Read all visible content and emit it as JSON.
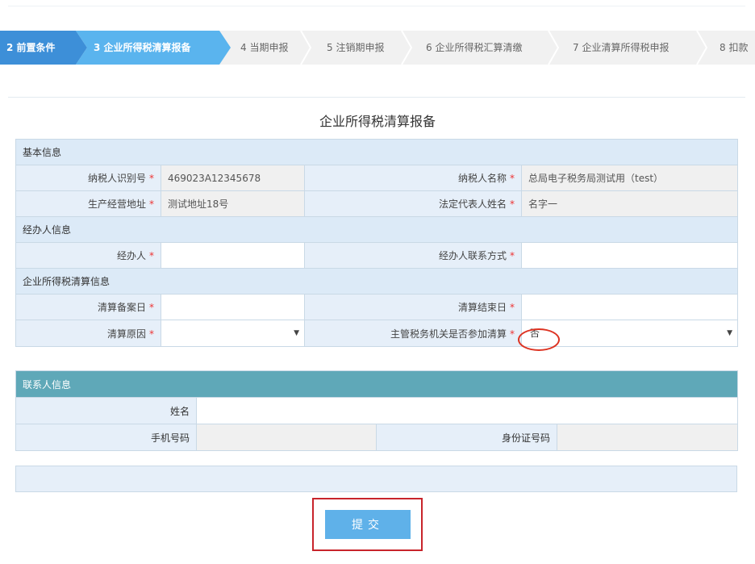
{
  "steps": [
    {
      "label": "2 前置条件",
      "state": "done"
    },
    {
      "label": "3 企业所得税清算报备",
      "state": "active"
    },
    {
      "label": "4 当期申报",
      "state": "todo"
    },
    {
      "label": "5 注销期申报",
      "state": "todo"
    },
    {
      "label": "6 企业所得税汇算清缴",
      "state": "todo"
    },
    {
      "label": "7 企业清算所得税申报",
      "state": "todo"
    },
    {
      "label": "8 扣款",
      "state": "todo"
    }
  ],
  "page_title": "企业所得税清算报备",
  "basic_section": "基本信息",
  "basic": {
    "taxpayer_id_label": "纳税人识别号",
    "taxpayer_id_value": "469023A12345678",
    "taxpayer_name_label": "纳税人名称",
    "taxpayer_name_value": "总局电子税务局测试用（test）",
    "address_label": "生产经营地址",
    "address_value": "测试地址18号",
    "legal_rep_label": "法定代表人姓名",
    "legal_rep_value": "名字一"
  },
  "agent_section": "经办人信息",
  "agent": {
    "agent_label": "经办人",
    "agent_value": "",
    "contact_label": "经办人联系方式",
    "contact_value": ""
  },
  "liq_section": "企业所得税清算信息",
  "liq": {
    "record_date_label": "清算备案日",
    "record_date_value": "",
    "end_date_label": "清算结束日",
    "end_date_value": "",
    "reason_label": "清算原因",
    "reason_value": "",
    "participate_label": "主管税务机关是否参加清算",
    "participate_value": "否"
  },
  "req_mark": "*",
  "contact_section": "联系人信息",
  "contact": {
    "name_label": "姓名",
    "name_value": "",
    "phone_label": "手机号码",
    "phone_value": "",
    "idcard_label": "身份证号码",
    "idcard_value": ""
  },
  "submit_label": "提交",
  "colors": {
    "step_done": "#3d8fd8",
    "step_active": "#5ab4ee",
    "section_bg": "#dceaf7",
    "contact_header": "#5fa8b8",
    "submit_bg": "#5fb1e9",
    "highlight_red": "#c8242b"
  }
}
